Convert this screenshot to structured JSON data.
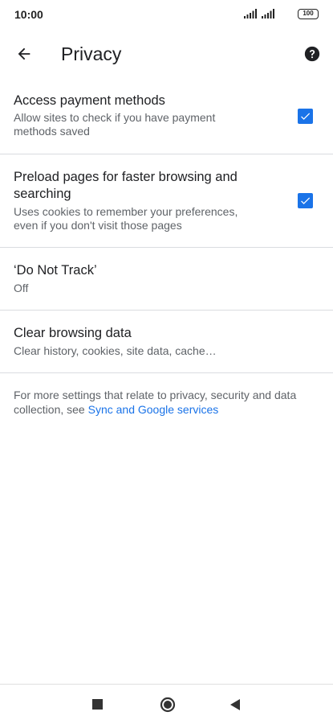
{
  "status_bar": {
    "time": "10:00",
    "battery": "100"
  },
  "app_bar": {
    "title": "Privacy"
  },
  "settings": [
    {
      "title": "Access payment methods",
      "summary": "Allow sites to check if you have payment methods saved",
      "checked": true
    },
    {
      "title": "Preload pages for faster browsing and searching",
      "summary": "Uses cookies to remember your preferences, even if you don't visit those pages",
      "checked": true
    },
    {
      "title": "‘Do Not Track’",
      "summary": "Off"
    },
    {
      "title": "Clear browsing data",
      "summary": "Clear history, cookies, site data, cache…"
    }
  ],
  "footer": {
    "text": "For more settings that relate to privacy, security and data collection, see ",
    "link": "Sync and Google services"
  },
  "icons": {
    "back": "arrow-left-icon",
    "help": "help-circle-icon",
    "checkbox": "check-icon",
    "nav_recents": "square-icon",
    "nav_home": "circle-icon",
    "nav_back": "triangle-back-icon"
  },
  "colors": {
    "accent": "#1a73e8",
    "text_primary": "#202124",
    "text_secondary": "#5f6368",
    "divider": "#dadce0"
  }
}
